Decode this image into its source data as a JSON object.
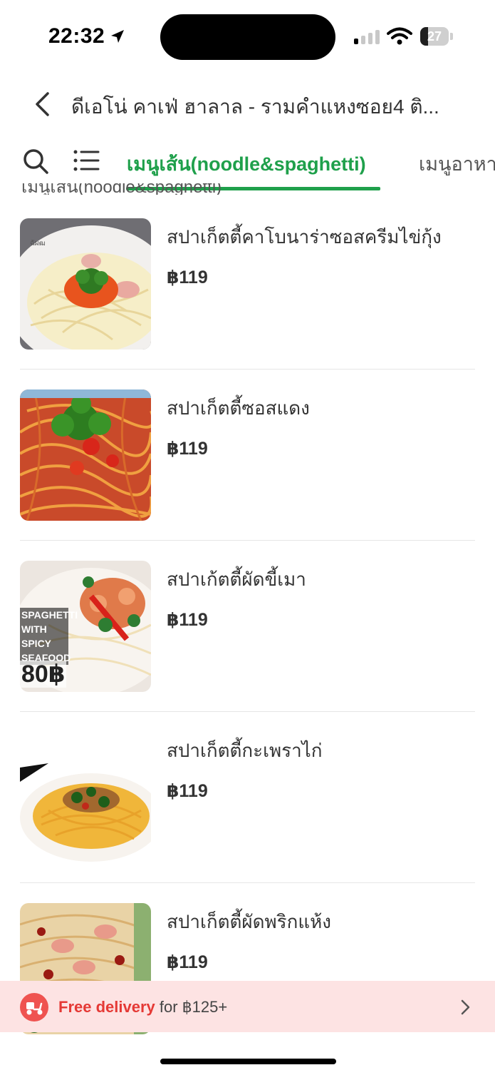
{
  "status": {
    "time": "22:32",
    "battery": "27",
    "battery_level": 0.27
  },
  "header": {
    "title": "ดีเอโน่ คาเฟ่ ฮาลาล - รามคำแหงซอย4 ติ..."
  },
  "tabs": {
    "active": "เมนูเส้น(noodle&spaghetti)",
    "next": "เมนูอาหาร"
  },
  "section_peek": "เมนูเส้น(noodle&spaghetti)",
  "menu": [
    {
      "name": "สปาเก็ตตี้คาโบนาร่าซอสครีมไข่กุ้ง",
      "price": "฿119"
    },
    {
      "name": "สปาเก็ตตี้ซอสแดง",
      "price": "฿119"
    },
    {
      "name": "สปาเก้ตตี้ผัดขี้เมา",
      "price": "฿119",
      "image_text": [
        "SPAGHETTI",
        "WITH SPICY",
        "SEAFOOD"
      ],
      "image_price": "80฿"
    },
    {
      "name": "สปาเก็ตตี้กะเพราไก่",
      "price": "฿119"
    },
    {
      "name": "สปาเก็ตตี้ผัดพริกแห้ง",
      "price": "฿119"
    }
  ],
  "promo": {
    "strong": "Free delivery",
    "rest": "for ฿125+"
  },
  "colors": {
    "accent_green": "#1fa04b",
    "promo_bg": "#fde3e3",
    "promo_red": "#e53935"
  },
  "icons": {
    "back": "chevron-left-icon",
    "search": "search-icon",
    "list": "list-icon",
    "promo": "delivery-scooter-icon",
    "promo_more": "chevron-right-icon"
  }
}
